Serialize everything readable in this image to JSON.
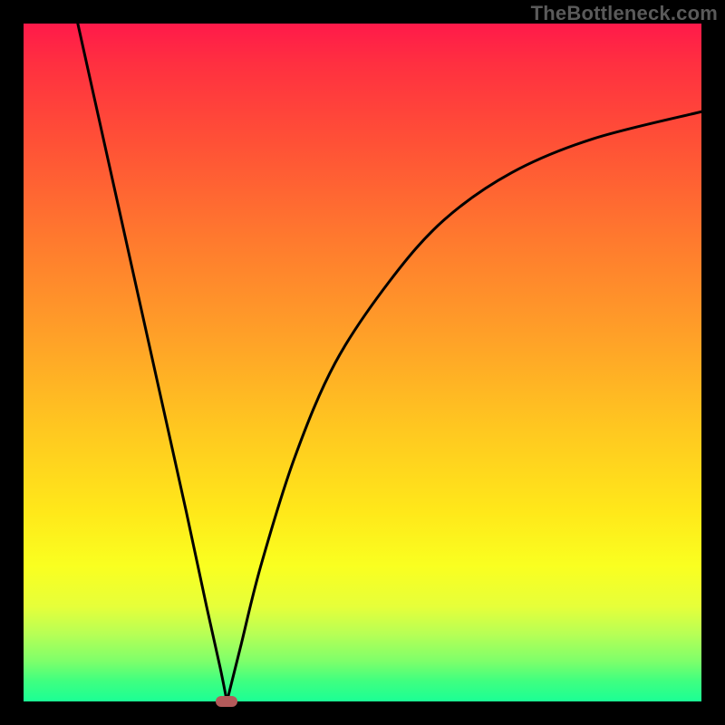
{
  "watermark": "TheBottleneck.com",
  "colors": {
    "frame": "#000000",
    "curve": "#000000",
    "marker": "#b35a5a",
    "gradient_top": "#ff1a4a",
    "gradient_bottom": "#1bff95"
  },
  "chart_data": {
    "type": "line",
    "title": "",
    "xlabel": "",
    "ylabel": "",
    "xlim": [
      0,
      100
    ],
    "ylim": [
      0,
      100
    ],
    "grid": false,
    "legend": false,
    "minimum_marker": {
      "x": 30,
      "y": 0
    },
    "series": [
      {
        "name": "left-branch",
        "x": [
          8,
          12,
          16,
          20,
          24,
          27,
          29,
          30
        ],
        "values": [
          100,
          82,
          64,
          46,
          28,
          14,
          5,
          0
        ]
      },
      {
        "name": "right-branch",
        "x": [
          30,
          32,
          35,
          40,
          46,
          54,
          62,
          72,
          84,
          100
        ],
        "values": [
          0,
          8,
          20,
          36,
          50,
          62,
          71,
          78,
          83,
          87
        ]
      }
    ]
  }
}
